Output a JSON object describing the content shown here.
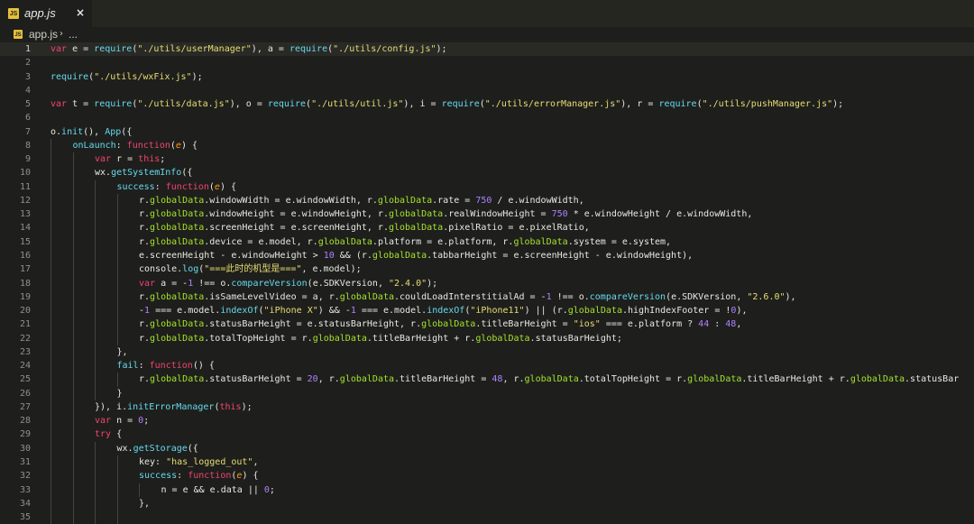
{
  "tab": {
    "label": "app.js",
    "icon": "js-file-icon",
    "close_glyph": "×"
  },
  "breadcrumb": {
    "file": "app.js",
    "separator": "›",
    "more": "..."
  },
  "editor": {
    "current_line": 1,
    "lines": [
      {
        "n": "1",
        "indent": 0,
        "tokens": [
          [
            "var",
            "kw"
          ],
          [
            " e = ",
            ""
          ],
          [
            "require",
            "fn"
          ],
          [
            "(",
            ""
          ],
          [
            "\"./utils/userManager\"",
            "str"
          ],
          [
            "), a = ",
            ""
          ],
          [
            "require",
            "fn"
          ],
          [
            "(",
            ""
          ],
          [
            "\"./utils/config.js\"",
            "str"
          ],
          [
            ");",
            ""
          ]
        ]
      },
      {
        "n": "2",
        "indent": 0,
        "tokens": []
      },
      {
        "n": "3",
        "indent": 0,
        "tokens": [
          [
            "require",
            "fn"
          ],
          [
            "(",
            ""
          ],
          [
            "\"./utils/wxFix.js\"",
            "str"
          ],
          [
            ");",
            ""
          ]
        ]
      },
      {
        "n": "4",
        "indent": 0,
        "tokens": []
      },
      {
        "n": "5",
        "indent": 0,
        "tokens": [
          [
            "var",
            "kw"
          ],
          [
            " t = ",
            ""
          ],
          [
            "require",
            "fn"
          ],
          [
            "(",
            ""
          ],
          [
            "\"./utils/data.js\"",
            "str"
          ],
          [
            "), o = ",
            ""
          ],
          [
            "require",
            "fn"
          ],
          [
            "(",
            ""
          ],
          [
            "\"./utils/util.js\"",
            "str"
          ],
          [
            "), i = ",
            ""
          ],
          [
            "require",
            "fn"
          ],
          [
            "(",
            ""
          ],
          [
            "\"./utils/errorManager.js\"",
            "str"
          ],
          [
            "), r = ",
            ""
          ],
          [
            "require",
            "fn"
          ],
          [
            "(",
            ""
          ],
          [
            "\"./utils/pushManager.js\"",
            "str"
          ],
          [
            ");",
            ""
          ]
        ]
      },
      {
        "n": "6",
        "indent": 0,
        "tokens": []
      },
      {
        "n": "7",
        "indent": 0,
        "tokens": [
          [
            "o.",
            ""
          ],
          [
            "init",
            "fn"
          ],
          [
            "(), ",
            ""
          ],
          [
            "App",
            "fn"
          ],
          [
            "({",
            ""
          ]
        ]
      },
      {
        "n": "8",
        "indent": 1,
        "tokens": [
          [
            "onLaunch",
            "fn"
          ],
          [
            ": ",
            ""
          ],
          [
            "function",
            "kw"
          ],
          [
            "(",
            ""
          ],
          [
            "e",
            "par"
          ],
          [
            ") {",
            ""
          ]
        ]
      },
      {
        "n": "9",
        "indent": 2,
        "tokens": [
          [
            "var",
            "kw"
          ],
          [
            " r = ",
            ""
          ],
          [
            "this",
            "kw"
          ],
          [
            ";",
            ""
          ]
        ]
      },
      {
        "n": "10",
        "indent": 2,
        "tokens": [
          [
            "wx.",
            ""
          ],
          [
            "getSystemInfo",
            "fn"
          ],
          [
            "({",
            ""
          ]
        ]
      },
      {
        "n": "11",
        "indent": 3,
        "tokens": [
          [
            "success",
            "fn"
          ],
          [
            ": ",
            ""
          ],
          [
            "function",
            "kw"
          ],
          [
            "(",
            ""
          ],
          [
            "e",
            "par"
          ],
          [
            ") {",
            ""
          ]
        ]
      },
      {
        "n": "12",
        "indent": 4,
        "tokens": [
          [
            "r.",
            ""
          ],
          [
            "globalData",
            "prop"
          ],
          [
            ".windowWidth = e.windowWidth, r.",
            ""
          ],
          [
            "globalData",
            "prop"
          ],
          [
            ".rate = ",
            ""
          ],
          [
            "750",
            "num"
          ],
          [
            " / e.windowWidth,",
            ""
          ]
        ]
      },
      {
        "n": "13",
        "indent": 4,
        "tokens": [
          [
            "r.",
            ""
          ],
          [
            "globalData",
            "prop"
          ],
          [
            ".windowHeight = e.windowHeight, r.",
            ""
          ],
          [
            "globalData",
            "prop"
          ],
          [
            ".realWindowHeight = ",
            ""
          ],
          [
            "750",
            "num"
          ],
          [
            " * e.windowHeight / e.windowWidth,",
            ""
          ]
        ]
      },
      {
        "n": "14",
        "indent": 4,
        "tokens": [
          [
            "r.",
            ""
          ],
          [
            "globalData",
            "prop"
          ],
          [
            ".screenHeight = e.screenHeight, r.",
            ""
          ],
          [
            "globalData",
            "prop"
          ],
          [
            ".pixelRatio = e.pixelRatio,",
            ""
          ]
        ]
      },
      {
        "n": "15",
        "indent": 4,
        "tokens": [
          [
            "r.",
            ""
          ],
          [
            "globalData",
            "prop"
          ],
          [
            ".device = e.model, r.",
            ""
          ],
          [
            "globalData",
            "prop"
          ],
          [
            ".platform = e.platform, r.",
            ""
          ],
          [
            "globalData",
            "prop"
          ],
          [
            ".system = e.system,",
            ""
          ]
        ]
      },
      {
        "n": "16",
        "indent": 4,
        "tokens": [
          [
            "e.screenHeight - e.windowHeight > ",
            ""
          ],
          [
            "10",
            "num"
          ],
          [
            " && (r.",
            ""
          ],
          [
            "globalData",
            "prop"
          ],
          [
            ".tabbarHeight = e.screenHeight - e.windowHeight),",
            ""
          ]
        ]
      },
      {
        "n": "17",
        "indent": 4,
        "tokens": [
          [
            "console.",
            ""
          ],
          [
            "log",
            "fn"
          ],
          [
            "(",
            ""
          ],
          [
            "\"===此时的机型是===\"",
            "str"
          ],
          [
            ", e.model);",
            ""
          ]
        ]
      },
      {
        "n": "18",
        "indent": 4,
        "tokens": [
          [
            "var",
            "kw"
          ],
          [
            " a = -",
            ""
          ],
          [
            "1",
            "num"
          ],
          [
            " !== o.",
            ""
          ],
          [
            "compareVersion",
            "fn"
          ],
          [
            "(e.SDKVersion, ",
            ""
          ],
          [
            "\"2.4.0\"",
            "str"
          ],
          [
            ");",
            ""
          ]
        ]
      },
      {
        "n": "19",
        "indent": 4,
        "tokens": [
          [
            "r.",
            ""
          ],
          [
            "globalData",
            "prop"
          ],
          [
            ".isSameLevelVideo = a, r.",
            ""
          ],
          [
            "globalData",
            "prop"
          ],
          [
            ".couldLoadInterstitialAd = -",
            ""
          ],
          [
            "1",
            "num"
          ],
          [
            " !== o.",
            ""
          ],
          [
            "compareVersion",
            "fn"
          ],
          [
            "(e.SDKVersion, ",
            ""
          ],
          [
            "\"2.6.0\"",
            "str"
          ],
          [
            "),",
            ""
          ]
        ]
      },
      {
        "n": "20",
        "indent": 4,
        "tokens": [
          [
            "-",
            ""
          ],
          [
            "1",
            "num"
          ],
          [
            " === e.model.",
            ""
          ],
          [
            "indexOf",
            "fn"
          ],
          [
            "(",
            ""
          ],
          [
            "\"iPhone X\"",
            "str"
          ],
          [
            ") && -",
            ""
          ],
          [
            "1",
            "num"
          ],
          [
            " === e.model.",
            ""
          ],
          [
            "indexOf",
            "fn"
          ],
          [
            "(",
            ""
          ],
          [
            "\"iPhone11\"",
            "str"
          ],
          [
            ") || (r.",
            ""
          ],
          [
            "globalData",
            "prop"
          ],
          [
            ".highIndexFooter = !",
            ""
          ],
          [
            "0",
            "num"
          ],
          [
            "),",
            ""
          ]
        ]
      },
      {
        "n": "21",
        "indent": 4,
        "tokens": [
          [
            "r.",
            ""
          ],
          [
            "globalData",
            "prop"
          ],
          [
            ".statusBarHeight = e.statusBarHeight, r.",
            ""
          ],
          [
            "globalData",
            "prop"
          ],
          [
            ".titleBarHeight = ",
            ""
          ],
          [
            "\"ios\"",
            "str"
          ],
          [
            " === e.platform ? ",
            ""
          ],
          [
            "44",
            "num"
          ],
          [
            " : ",
            ""
          ],
          [
            "48",
            "num"
          ],
          [
            ",",
            ""
          ]
        ]
      },
      {
        "n": "22",
        "indent": 4,
        "tokens": [
          [
            "r.",
            ""
          ],
          [
            "globalData",
            "prop"
          ],
          [
            ".totalTopHeight = r.",
            ""
          ],
          [
            "globalData",
            "prop"
          ],
          [
            ".titleBarHeight + r.",
            ""
          ],
          [
            "globalData",
            "prop"
          ],
          [
            ".statusBarHeight;",
            ""
          ]
        ]
      },
      {
        "n": "23",
        "indent": 3,
        "tokens": [
          [
            "},",
            ""
          ]
        ]
      },
      {
        "n": "24",
        "indent": 3,
        "tokens": [
          [
            "fail",
            "fn"
          ],
          [
            ": ",
            ""
          ],
          [
            "function",
            "kw"
          ],
          [
            "() {",
            ""
          ]
        ]
      },
      {
        "n": "25",
        "indent": 4,
        "tokens": [
          [
            "r.",
            ""
          ],
          [
            "globalData",
            "prop"
          ],
          [
            ".statusBarHeight = ",
            ""
          ],
          [
            "20",
            "num"
          ],
          [
            ", r.",
            ""
          ],
          [
            "globalData",
            "prop"
          ],
          [
            ".titleBarHeight = ",
            ""
          ],
          [
            "48",
            "num"
          ],
          [
            ", r.",
            ""
          ],
          [
            "globalData",
            "prop"
          ],
          [
            ".totalTopHeight = r.",
            ""
          ],
          [
            "globalData",
            "prop"
          ],
          [
            ".titleBarHeight + r.",
            ""
          ],
          [
            "globalData",
            "prop"
          ],
          [
            ".statusBar",
            ""
          ]
        ]
      },
      {
        "n": "26",
        "indent": 3,
        "tokens": [
          [
            "}",
            ""
          ]
        ]
      },
      {
        "n": "27",
        "indent": 2,
        "tokens": [
          [
            "}), i.",
            ""
          ],
          [
            "initErrorManager",
            "fn"
          ],
          [
            "(",
            ""
          ],
          [
            "this",
            "kw"
          ],
          [
            ");",
            ""
          ]
        ]
      },
      {
        "n": "28",
        "indent": 2,
        "tokens": [
          [
            "var",
            "kw"
          ],
          [
            " n = ",
            ""
          ],
          [
            "0",
            "num"
          ],
          [
            ";",
            ""
          ]
        ]
      },
      {
        "n": "29",
        "indent": 2,
        "tokens": [
          [
            "try",
            "kw"
          ],
          [
            " {",
            ""
          ]
        ]
      },
      {
        "n": "30",
        "indent": 3,
        "tokens": [
          [
            "wx.",
            ""
          ],
          [
            "getStorage",
            "fn"
          ],
          [
            "({",
            ""
          ]
        ]
      },
      {
        "n": "31",
        "indent": 4,
        "tokens": [
          [
            "key: ",
            ""
          ],
          [
            "\"has_logged_out\"",
            "str"
          ],
          [
            ",",
            ""
          ]
        ]
      },
      {
        "n": "32",
        "indent": 4,
        "tokens": [
          [
            "success",
            "fn"
          ],
          [
            ": ",
            ""
          ],
          [
            "function",
            "kw"
          ],
          [
            "(",
            ""
          ],
          [
            "e",
            "par"
          ],
          [
            ") {",
            ""
          ]
        ]
      },
      {
        "n": "33",
        "indent": 5,
        "tokens": [
          [
            "n = e && e.data || ",
            ""
          ],
          [
            "0",
            "num"
          ],
          [
            ";",
            ""
          ]
        ]
      },
      {
        "n": "34",
        "indent": 4,
        "tokens": [
          [
            "},",
            ""
          ]
        ]
      },
      {
        "n": "35",
        "indent": 4,
        "tokens": []
      }
    ]
  }
}
